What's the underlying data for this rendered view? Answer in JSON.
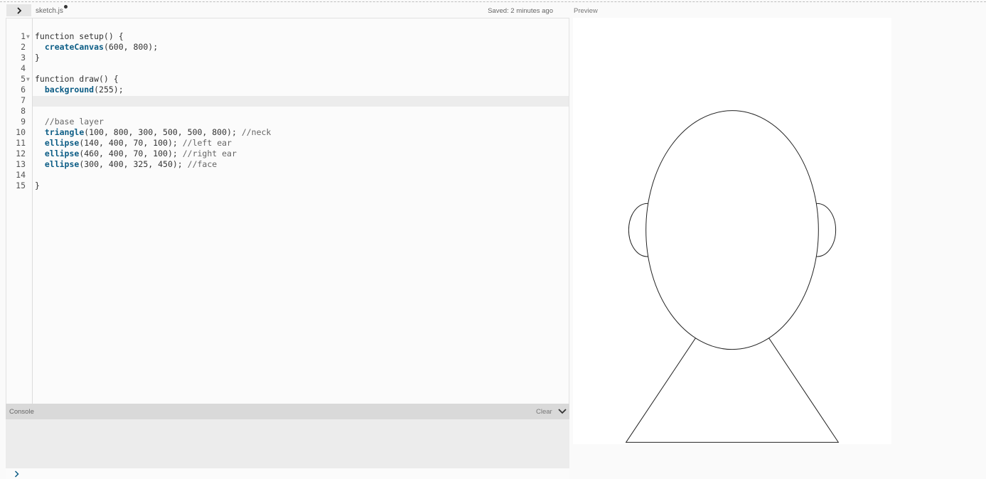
{
  "header": {
    "filename": "sketch.js",
    "saved_status": "Saved: 2 minutes ago",
    "preview_label": "Preview"
  },
  "editor": {
    "lines": [
      {
        "n": "1",
        "fold": true,
        "segments": [
          {
            "t": "function setup() {",
            "c": "plain"
          }
        ]
      },
      {
        "n": "2",
        "fold": false,
        "segments": [
          {
            "t": "  ",
            "c": "plain"
          },
          {
            "t": "createCanvas",
            "c": "fn"
          },
          {
            "t": "(600, 800);",
            "c": "plain"
          }
        ]
      },
      {
        "n": "3",
        "fold": false,
        "segments": [
          {
            "t": "}",
            "c": "plain"
          }
        ]
      },
      {
        "n": "4",
        "fold": false,
        "segments": []
      },
      {
        "n": "5",
        "fold": true,
        "segments": [
          {
            "t": "function draw() {",
            "c": "plain"
          }
        ]
      },
      {
        "n": "6",
        "fold": false,
        "segments": [
          {
            "t": "  ",
            "c": "plain"
          },
          {
            "t": "background",
            "c": "fn"
          },
          {
            "t": "(255);",
            "c": "plain"
          }
        ]
      },
      {
        "n": "7",
        "fold": false,
        "segments": []
      },
      {
        "n": "8",
        "fold": false,
        "segments": []
      },
      {
        "n": "9",
        "fold": false,
        "segments": [
          {
            "t": "  ",
            "c": "plain"
          },
          {
            "t": "//base layer",
            "c": "cm"
          }
        ]
      },
      {
        "n": "10",
        "fold": false,
        "segments": [
          {
            "t": "  ",
            "c": "plain"
          },
          {
            "t": "triangle",
            "c": "fn"
          },
          {
            "t": "(100, 800, 300, 500, 500, 800); ",
            "c": "plain"
          },
          {
            "t": "//neck",
            "c": "cm"
          }
        ]
      },
      {
        "n": "11",
        "fold": false,
        "segments": [
          {
            "t": "  ",
            "c": "plain"
          },
          {
            "t": "ellipse",
            "c": "fn"
          },
          {
            "t": "(140, 400, 70, 100); ",
            "c": "plain"
          },
          {
            "t": "//left ear",
            "c": "cm"
          }
        ]
      },
      {
        "n": "12",
        "fold": false,
        "segments": [
          {
            "t": "  ",
            "c": "plain"
          },
          {
            "t": "ellipse",
            "c": "fn"
          },
          {
            "t": "(460, 400, 70, 100); ",
            "c": "plain"
          },
          {
            "t": "//right ear",
            "c": "cm"
          }
        ]
      },
      {
        "n": "13",
        "fold": false,
        "segments": [
          {
            "t": "  ",
            "c": "plain"
          },
          {
            "t": "ellipse",
            "c": "fn"
          },
          {
            "t": "(300, 400, 325, 450); ",
            "c": "plain"
          },
          {
            "t": "//face",
            "c": "cm"
          }
        ]
      },
      {
        "n": "14",
        "fold": false,
        "segments": []
      },
      {
        "n": "15",
        "fold": false,
        "segments": [
          {
            "t": "}",
            "c": "plain"
          }
        ]
      }
    ]
  },
  "console": {
    "label": "Console",
    "clear_label": "Clear"
  },
  "icons": {
    "expand": "chevron-right-icon",
    "collapse_console": "chevron-down-icon",
    "prompt": "chevron-right-icon",
    "unsaved": "dot-icon"
  },
  "colors": {
    "function": "#0b5c85",
    "comment": "#666666",
    "prompt": "#0b5c85"
  },
  "sketch": {
    "canvas": {
      "w": 600,
      "h": 800
    },
    "background": 255,
    "shapes": [
      {
        "kind": "triangle",
        "args": [
          100,
          800,
          300,
          500,
          500,
          800
        ],
        "label": "neck"
      },
      {
        "kind": "ellipse",
        "args": [
          140,
          400,
          70,
          100
        ],
        "label": "left ear"
      },
      {
        "kind": "ellipse",
        "args": [
          460,
          400,
          70,
          100
        ],
        "label": "right ear"
      },
      {
        "kind": "ellipse",
        "args": [
          300,
          400,
          325,
          450
        ],
        "label": "face"
      }
    ]
  }
}
